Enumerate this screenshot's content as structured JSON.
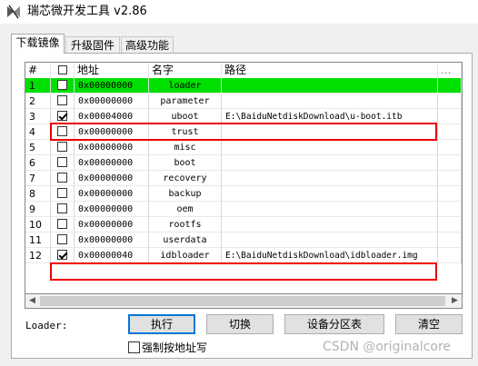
{
  "window": {
    "title": "瑞芯微开发工具 v2.86",
    "icon": "rockchip-app-icon"
  },
  "tabs": [
    {
      "label": "下载镜像"
    },
    {
      "label": "升级固件"
    },
    {
      "label": "高级功能"
    }
  ],
  "table": {
    "headers": {
      "num": "#",
      "check": "☐",
      "addr": "地址",
      "name": "名字",
      "path": "路径",
      "more": "..."
    },
    "rows": [
      {
        "num": "1",
        "checked": false,
        "addr": "0x00000000",
        "name": "loader",
        "path": "",
        "highlighted": true
      },
      {
        "num": "2",
        "checked": false,
        "addr": "0x00000000",
        "name": "parameter",
        "path": ""
      },
      {
        "num": "3",
        "checked": true,
        "addr": "0x00004000",
        "name": "uboot",
        "path": "E:\\BaiduNetdiskDownload\\u-boot.itb"
      },
      {
        "num": "4",
        "checked": false,
        "addr": "0x00000000",
        "name": "trust",
        "path": ""
      },
      {
        "num": "5",
        "checked": false,
        "addr": "0x00000000",
        "name": "misc",
        "path": ""
      },
      {
        "num": "6",
        "checked": false,
        "addr": "0x00000000",
        "name": "boot",
        "path": ""
      },
      {
        "num": "7",
        "checked": false,
        "addr": "0x00000000",
        "name": "recovery",
        "path": ""
      },
      {
        "num": "8",
        "checked": false,
        "addr": "0x00000000",
        "name": "backup",
        "path": ""
      },
      {
        "num": "9",
        "checked": false,
        "addr": "0x00000000",
        "name": "oem",
        "path": ""
      },
      {
        "num": "10",
        "checked": false,
        "addr": "0x00000000",
        "name": "rootfs",
        "path": ""
      },
      {
        "num": "11",
        "checked": false,
        "addr": "0x00000000",
        "name": "userdata",
        "path": ""
      },
      {
        "num": "12",
        "checked": true,
        "addr": "0x00000040",
        "name": "idbloader",
        "path": "E:\\BaiduNetdiskDownload\\idbloader.img"
      }
    ]
  },
  "footer": {
    "loader_label": "Loader:",
    "buttons": {
      "execute": "执行",
      "switch": "切换",
      "partition_table": "设备分区表",
      "clear": "清空"
    },
    "force_addr_label": "强制按地址写",
    "force_addr_checked": false
  },
  "watermark": "CSDN @originalcore",
  "colors": {
    "highlight_row": "#00e000",
    "annotation_box": "#e00000",
    "focused_button_border": "#0078d7"
  }
}
